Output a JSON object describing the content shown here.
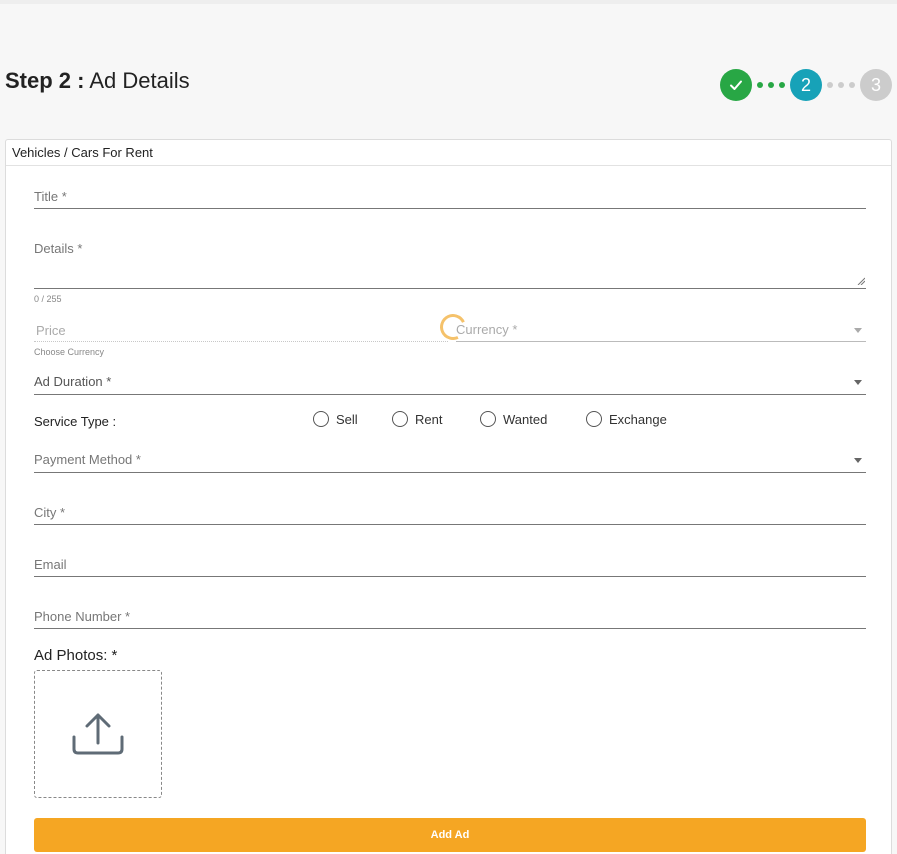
{
  "header": {
    "step_prefix": "Step 2 :",
    "step_title": "Ad Details"
  },
  "stepper": {
    "steps": [
      {
        "label": "✓",
        "state": "done"
      },
      {
        "label": "2",
        "state": "active"
      },
      {
        "label": "3",
        "state": "pending"
      }
    ],
    "colors": {
      "done": "#28a745",
      "active": "#17a2b8",
      "pending": "#cccccc"
    }
  },
  "form": {
    "category": "Vehicles / Cars For Rent",
    "title_label": "Title *",
    "details_label": "Details *",
    "details_counter": "0 / 255",
    "price_placeholder": "Price",
    "currency_label": "Currency *",
    "currency_helper": "Choose Currency",
    "ad_duration_label": "Ad Duration *",
    "service_type_label": "Service Type :",
    "service_options": [
      "Sell",
      "Rent",
      "Wanted",
      "Exchange"
    ],
    "payment_method_label": "Payment Method *",
    "city_label": "City *",
    "email_label": "Email",
    "phone_label": "Phone Number *",
    "photos_label": "Ad Photos: *",
    "upload_icon": "upload-icon",
    "submit_label": "Add Ad"
  },
  "colors": {
    "accent": "#f5a623",
    "spinner": "#f5c26b"
  }
}
